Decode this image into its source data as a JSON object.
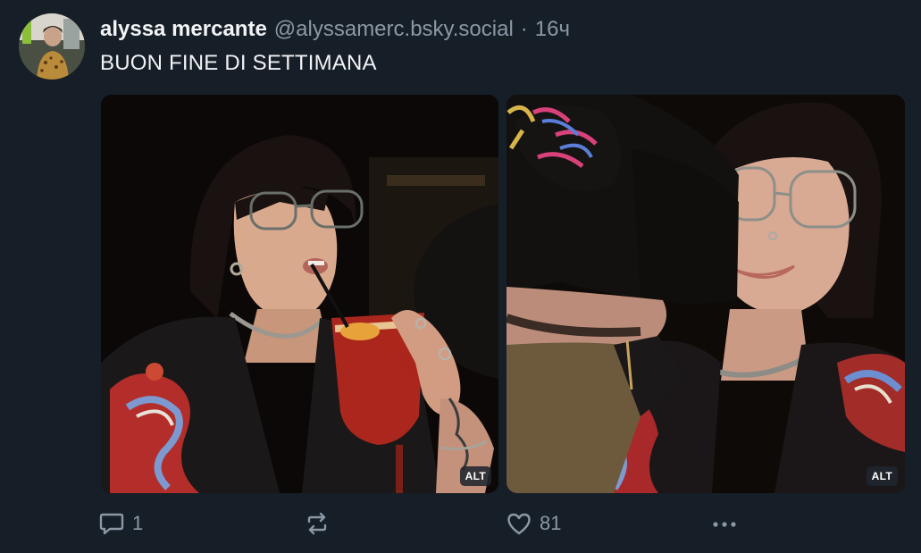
{
  "author": {
    "display_name": "alyssa mercante",
    "handle": "@alyssamerc.bsky.social",
    "separator": "·",
    "time": "16ч"
  },
  "post": {
    "text": "BUON FINE DI SETTIMANA",
    "images": [
      {
        "alt_badge": "ALT"
      },
      {
        "alt_badge": "ALT"
      }
    ]
  },
  "actions": {
    "reply_count": "1",
    "like_count": "81",
    "icons": [
      "reply-icon",
      "repost-icon",
      "heart-icon",
      "more-icon"
    ]
  },
  "colors": {
    "background": "#161e27",
    "text": "#f1f3f5",
    "muted": "#8b98a5"
  }
}
